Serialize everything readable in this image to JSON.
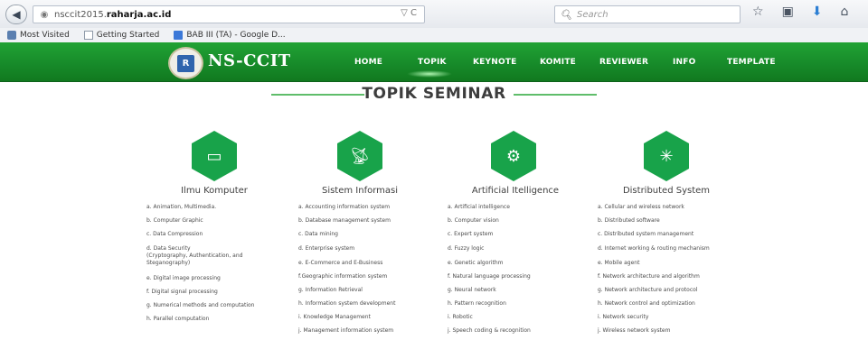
{
  "browser": {
    "url_prefix": "nsccit2015.",
    "url_domain": "raharja.ac.id",
    "search_placeholder": "Search",
    "url_actions": "▽ C",
    "bookmarks": [
      {
        "label": "Most Visited"
      },
      {
        "label": "Getting Started"
      },
      {
        "label": "BAB III (TA) - Google D..."
      }
    ]
  },
  "site": {
    "brand": "NS-CCIT",
    "logo_mark": "R",
    "menu": [
      "HOME",
      "TOPIK",
      "KEYNOTE",
      "KOMITE",
      "REVIEWER",
      "INFO",
      "TEMPLATE"
    ],
    "active_menu": "TOPIK"
  },
  "page": {
    "title": "TOPIK SEMINAR",
    "columns": [
      {
        "title": "Ilmu Komputer",
        "icon": "laptop-icon",
        "items": [
          "a. Animation, Multimedia.",
          "b. Computer Graphic",
          "c. Data Compression",
          "d. Data Security",
          "(Cryptography, Authentication, and",
          "Steganography)",
          "e. Digital image processing",
          "f. Digital signal processing",
          "g. Numerical methods and computation",
          "h. Parallel computation"
        ]
      },
      {
        "title": "Sistem Informasi",
        "icon": "satellite-icon",
        "items": [
          "a. Accounting information system",
          "b. Database management system",
          "c. Data mining",
          "d. Enterprise system",
          "e. E-Commerce and E-Business",
          "f.Geographic information system",
          "g. Information Retrieval",
          "h. Information system development",
          "i. Knowledge Management",
          "j. Management information system"
        ]
      },
      {
        "title": "Artificial Itelligence",
        "icon": "brain-gear-icon",
        "items": [
          "a. Artificial intelligence",
          "b. Computer vision",
          "c. Expert system",
          "d. Fuzzy logic",
          "e. Genetic algorithm",
          "f. Natural language processing",
          "g. Neural network",
          "h. Pattern recognition",
          "i. Robotic",
          "j. Speech coding & recognition"
        ]
      },
      {
        "title": "Distributed System",
        "icon": "network-icon",
        "items": [
          "a. Cellular and wireless network",
          "b. Distributed software",
          "c. Distributed system management",
          "d. Internet working & routing mechanism",
          "e. Mobile agent",
          "f. Network architecture and algorithm",
          "g. Network architecture and protocol",
          "h. Network control and optimization",
          "i. Network security",
          "j. Wireless network system"
        ]
      }
    ]
  },
  "colors": {
    "accent": "#18A34A",
    "nav": "#1C9A2E"
  }
}
